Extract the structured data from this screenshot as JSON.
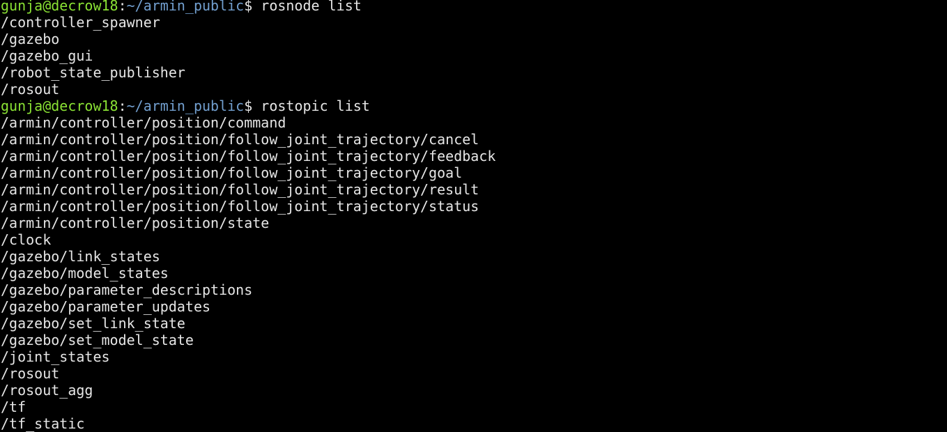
{
  "prompt": {
    "user_host": "gunja@decrow18",
    "separator": ":",
    "path": "~/armin_public",
    "symbol": "$ "
  },
  "blocks": [
    {
      "command": "rosnode list",
      "output": [
        "/controller_spawner",
        "/gazebo",
        "/gazebo_gui",
        "/robot_state_publisher",
        "/rosout"
      ]
    },
    {
      "command": "rostopic list",
      "output": [
        "/armin/controller/position/command",
        "/armin/controller/position/follow_joint_trajectory/cancel",
        "/armin/controller/position/follow_joint_trajectory/feedback",
        "/armin/controller/position/follow_joint_trajectory/goal",
        "/armin/controller/position/follow_joint_trajectory/result",
        "/armin/controller/position/follow_joint_trajectory/status",
        "/armin/controller/position/state",
        "/clock",
        "/gazebo/link_states",
        "/gazebo/model_states",
        "/gazebo/parameter_descriptions",
        "/gazebo/parameter_updates",
        "/gazebo/set_link_state",
        "/gazebo/set_model_state",
        "/joint_states",
        "/rosout",
        "/rosout_agg",
        "/tf",
        "/tf_static"
      ]
    }
  ],
  "colors": {
    "background": "#000000",
    "user_host": "#8ae234",
    "path": "#729fcf",
    "text": "#e6e6e6"
  }
}
